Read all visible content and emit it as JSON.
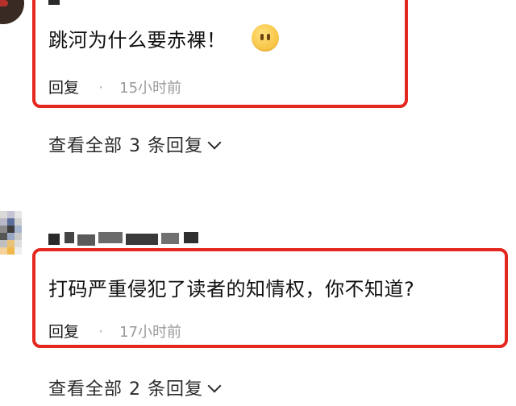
{
  "thread1": {
    "comment": "跳河为什么要赤裸！",
    "emoji": "no-mouth-face",
    "reply_label": "回复",
    "separator": "·",
    "time": "15小时前",
    "view_all": "查看全部 3 条回复"
  },
  "thread2": {
    "comment": "打码严重侵犯了读者的知情权，你不知道?",
    "reply_label": "回复",
    "separator": "·",
    "time": "17小时前",
    "view_all": "查看全部 2 条回复"
  },
  "colors": {
    "highlight": "#e4281f",
    "text": "#111111",
    "meta": "#9a9a9a"
  }
}
